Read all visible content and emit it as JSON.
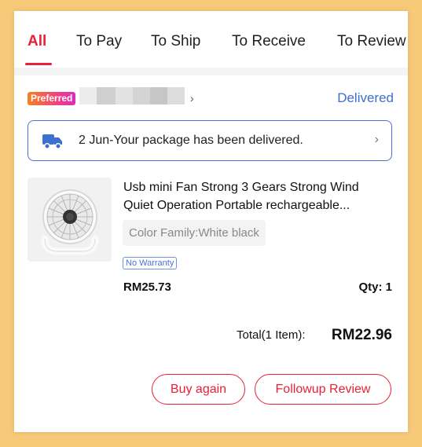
{
  "tabs": [
    {
      "label": "All",
      "active": true
    },
    {
      "label": "To Pay",
      "active": false
    },
    {
      "label": "To Ship",
      "active": false
    },
    {
      "label": "To Receive",
      "active": false
    },
    {
      "label": "To Review",
      "active": false
    }
  ],
  "order": {
    "badge": "Preferred",
    "shop_chevron": "›",
    "status": "Delivered",
    "delivery_message": "2 Jun-Your package has been delivered.",
    "delivery_chevron": "›",
    "delivery_icon": "truck-icon"
  },
  "product": {
    "title_line1": "Usb mini Fan Strong 3 Gears Strong Wind",
    "title_line2": "Quiet Operation Portable rechargeable...",
    "variant": "Color Family:White black",
    "warranty": "No Warranty",
    "price": "RM25.73",
    "qty": "Qty: 1"
  },
  "total": {
    "label": "Total(1 Item):",
    "value": "RM22.96"
  },
  "actions": {
    "buy_again": "Buy again",
    "followup_review": "Followup Review"
  },
  "colors": {
    "accent": "#e8213a",
    "link_blue": "#3d6fd1",
    "background": "#f9c97a"
  }
}
